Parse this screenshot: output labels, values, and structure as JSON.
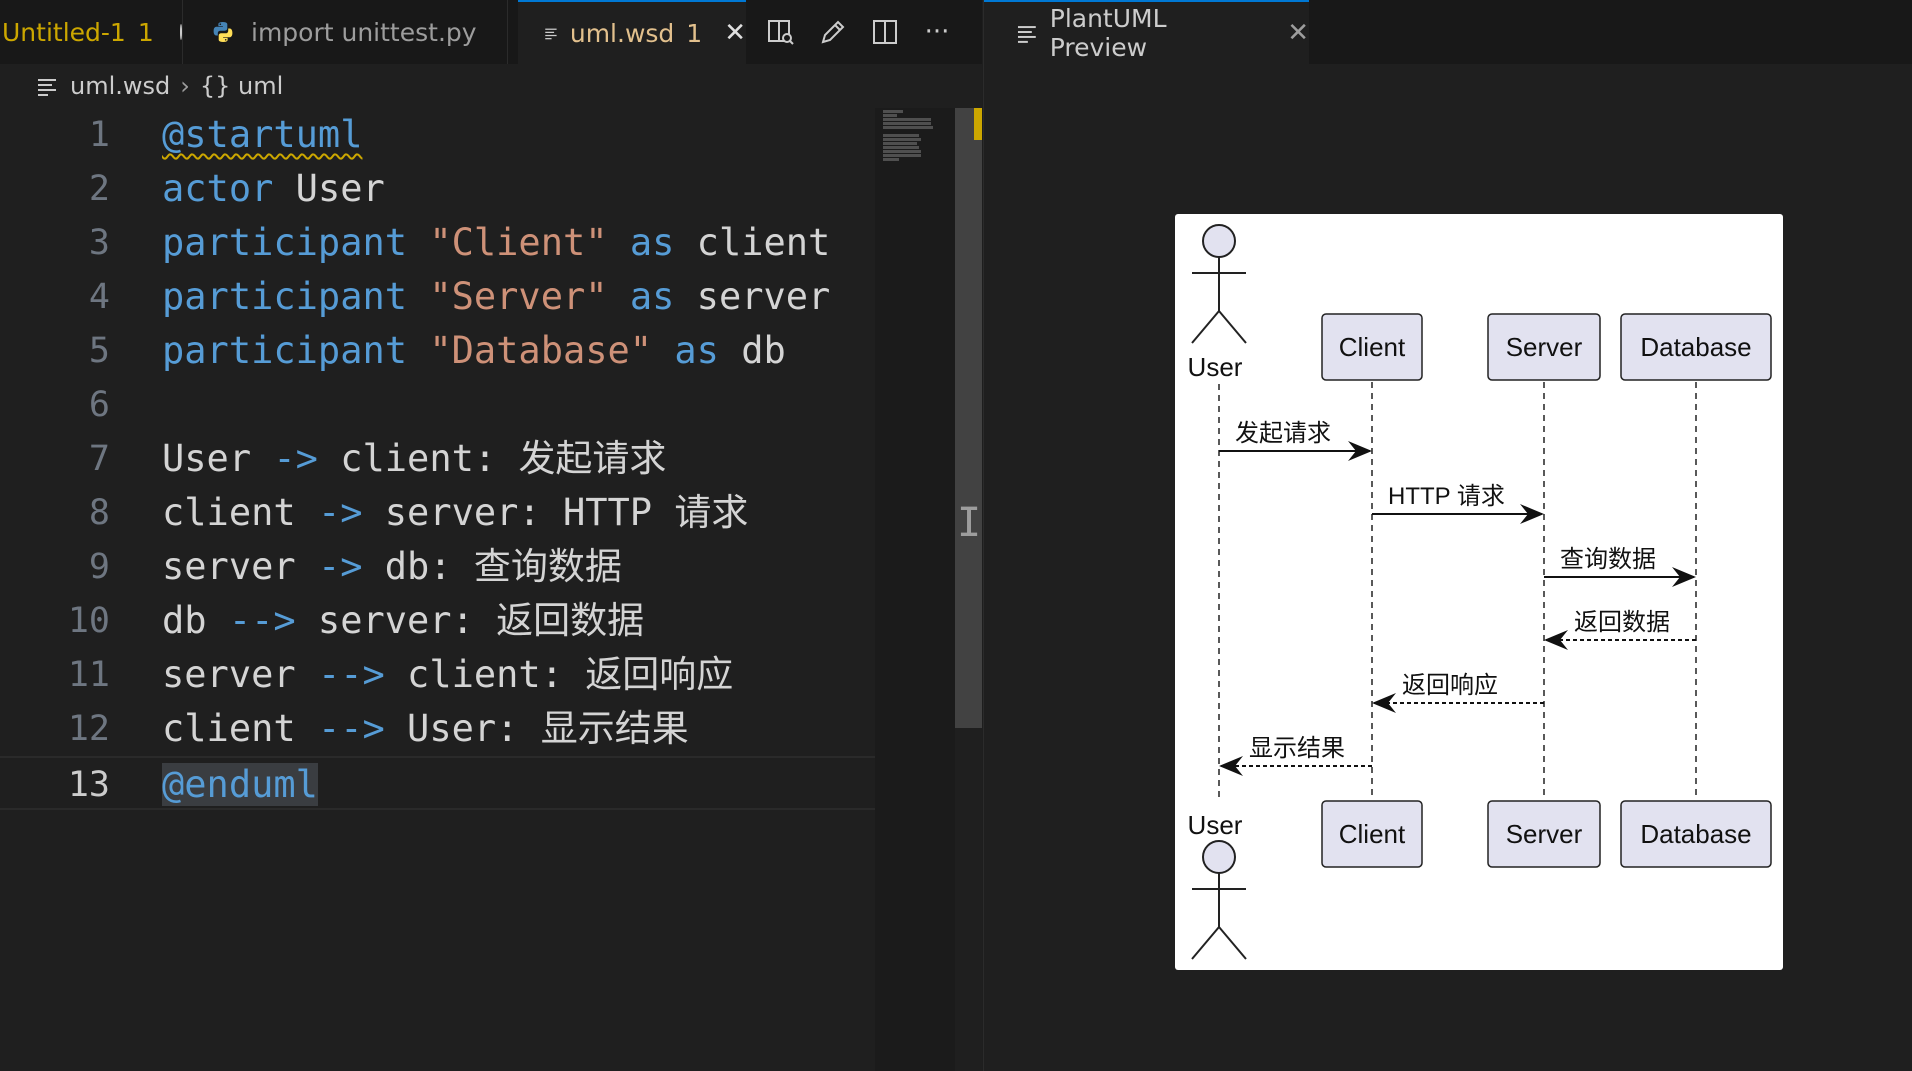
{
  "tabs": [
    {
      "label": "Untitled-1",
      "badge": "1",
      "state": "modified"
    },
    {
      "label": "import unittest.py",
      "icon": "python-icon"
    },
    {
      "label": "uml.wsd",
      "badge": "1",
      "active": true
    }
  ],
  "breadcrumb": {
    "file": "uml.wsd",
    "symbol": "{} uml"
  },
  "code": {
    "lines": [
      {
        "n": "1",
        "tokens": [
          {
            "t": "@startuml",
            "c": "kw squiggle"
          }
        ]
      },
      {
        "n": "2",
        "tokens": [
          {
            "t": "actor",
            "c": "kw"
          },
          {
            "t": " User",
            "c": "id"
          }
        ]
      },
      {
        "n": "3",
        "tokens": [
          {
            "t": "participant",
            "c": "kw"
          },
          {
            "t": " ",
            "c": "id"
          },
          {
            "t": "\"Client\"",
            "c": "str"
          },
          {
            "t": " ",
            "c": "id"
          },
          {
            "t": "as",
            "c": "kw"
          },
          {
            "t": " client",
            "c": "id"
          }
        ]
      },
      {
        "n": "4",
        "tokens": [
          {
            "t": "participant",
            "c": "kw"
          },
          {
            "t": " ",
            "c": "id"
          },
          {
            "t": "\"Server\"",
            "c": "str"
          },
          {
            "t": " ",
            "c": "id"
          },
          {
            "t": "as",
            "c": "kw"
          },
          {
            "t": " server",
            "c": "id"
          }
        ]
      },
      {
        "n": "5",
        "tokens": [
          {
            "t": "participant",
            "c": "kw"
          },
          {
            "t": " ",
            "c": "id"
          },
          {
            "t": "\"Database\"",
            "c": "str"
          },
          {
            "t": " ",
            "c": "id"
          },
          {
            "t": "as",
            "c": "kw"
          },
          {
            "t": " db",
            "c": "id"
          }
        ]
      },
      {
        "n": "6",
        "tokens": []
      },
      {
        "n": "7",
        "tokens": [
          {
            "t": "User ",
            "c": "id"
          },
          {
            "t": "->",
            "c": "op"
          },
          {
            "t": " client: ",
            "c": "id"
          },
          {
            "t": "发起请求",
            "c": "id cjk"
          }
        ]
      },
      {
        "n": "8",
        "tokens": [
          {
            "t": "client ",
            "c": "id"
          },
          {
            "t": "->",
            "c": "op"
          },
          {
            "t": " server: HTTP ",
            "c": "id"
          },
          {
            "t": "请求",
            "c": "id cjk"
          }
        ]
      },
      {
        "n": "9",
        "tokens": [
          {
            "t": "server ",
            "c": "id"
          },
          {
            "t": "->",
            "c": "op"
          },
          {
            "t": " db: ",
            "c": "id"
          },
          {
            "t": "查询数据",
            "c": "id cjk"
          }
        ]
      },
      {
        "n": "10",
        "tokens": [
          {
            "t": "db ",
            "c": "id"
          },
          {
            "t": "-->",
            "c": "op"
          },
          {
            "t": " server: ",
            "c": "id"
          },
          {
            "t": "返回数据",
            "c": "id cjk"
          }
        ]
      },
      {
        "n": "11",
        "tokens": [
          {
            "t": "server ",
            "c": "id"
          },
          {
            "t": "-->",
            "c": "op"
          },
          {
            "t": " client: ",
            "c": "id"
          },
          {
            "t": "返回响应",
            "c": "id cjk"
          }
        ]
      },
      {
        "n": "12",
        "tokens": [
          {
            "t": "client ",
            "c": "id"
          },
          {
            "t": "-->",
            "c": "op"
          },
          {
            "t": " User: ",
            "c": "id"
          },
          {
            "t": "显示结果",
            "c": "id cjk"
          }
        ]
      },
      {
        "n": "13",
        "tokens": [
          {
            "t": "@enduml",
            "c": "kw sel-word"
          }
        ],
        "current": true
      }
    ]
  },
  "preview": {
    "tab_label": "PlantUML Preview",
    "diagram": {
      "actor": "User",
      "participants": [
        "Client",
        "Server",
        "Database"
      ],
      "messages": [
        {
          "from": "User",
          "to": "Client",
          "label": "发起请求",
          "style": "solid"
        },
        {
          "from": "Client",
          "to": "Server",
          "label": "HTTP 请求",
          "style": "solid"
        },
        {
          "from": "Server",
          "to": "Database",
          "label": "查询数据",
          "style": "solid"
        },
        {
          "from": "Database",
          "to": "Server",
          "label": "返回数据",
          "style": "dashed"
        },
        {
          "from": "Server",
          "to": "Client",
          "label": "返回响应",
          "style": "dashed"
        },
        {
          "from": "Client",
          "to": "User",
          "label": "显示结果",
          "style": "dashed"
        }
      ]
    }
  },
  "colors": {
    "editor_bg": "#1f1f1f",
    "keyword": "#569cd6",
    "string": "#ce9178",
    "modified_tab": "#e2c08d",
    "participant_fill": "#e2e2f0",
    "warning": "#cca700"
  }
}
